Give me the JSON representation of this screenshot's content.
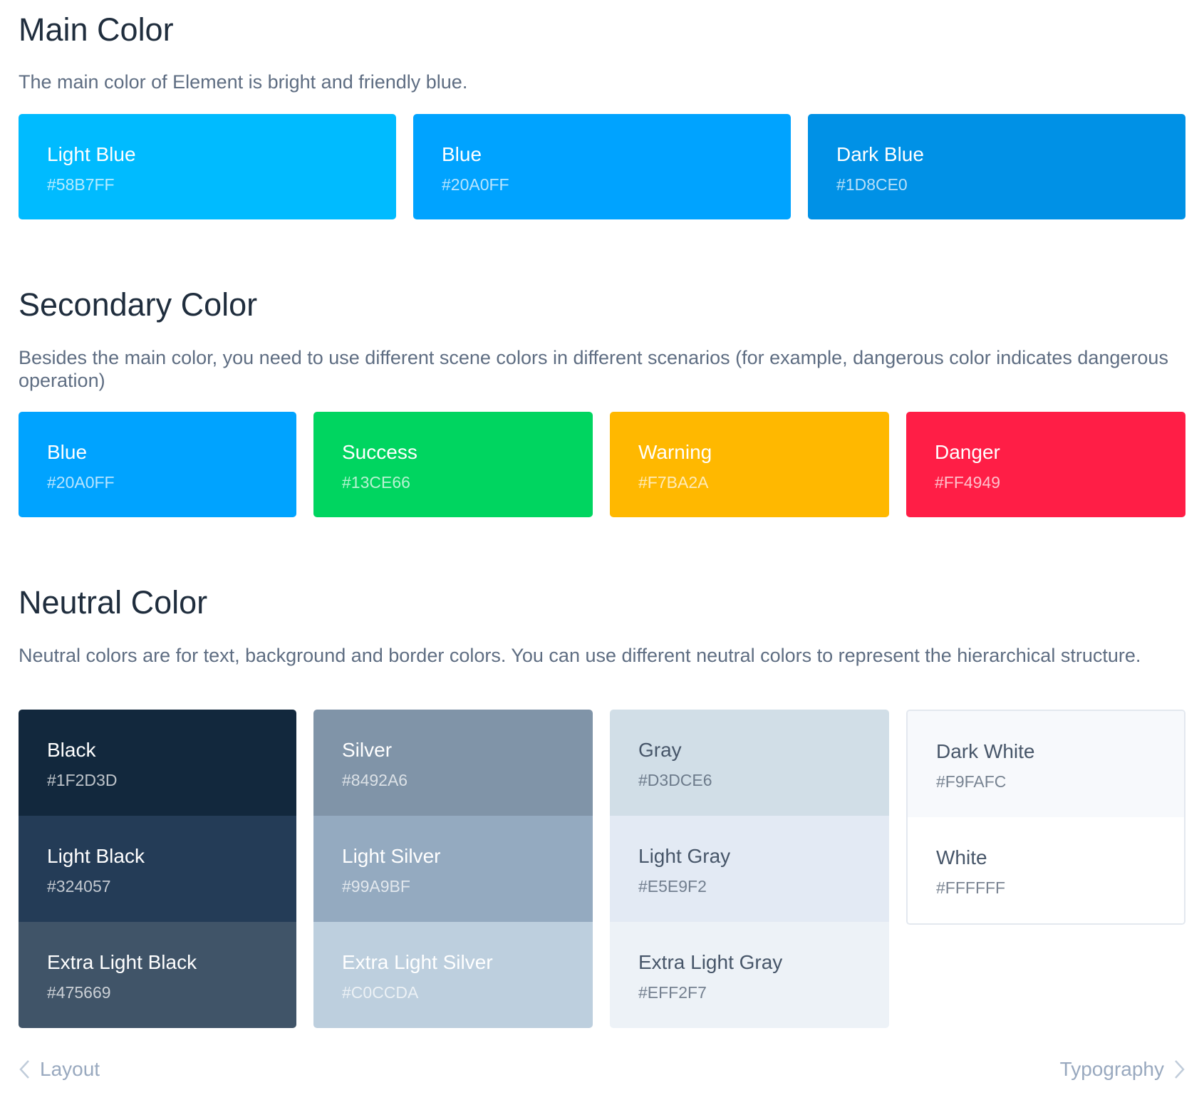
{
  "main": {
    "title": "Main Color",
    "desc": "The main color of Element is bright and friendly blue.",
    "swatches": [
      {
        "name": "Light Blue",
        "hex": "#58B7FF",
        "color": "#00BBFF"
      },
      {
        "name": "Blue",
        "hex": "#20A0FF",
        "color": "#00A3FF"
      },
      {
        "name": "Dark Blue",
        "hex": "#1D8CE0",
        "color": "#0091E6"
      }
    ]
  },
  "secondary": {
    "title": "Secondary Color",
    "desc": "Besides the main color, you need to use different scene colors in different scenarios (for example, dangerous color indicates dangerous operation)",
    "swatches": [
      {
        "name": "Blue",
        "hex": "#20A0FF",
        "color": "#00A3FF"
      },
      {
        "name": "Success",
        "hex": "#13CE66",
        "color": "#00D560"
      },
      {
        "name": "Warning",
        "hex": "#F7BA2A",
        "color": "#FFB800"
      },
      {
        "name": "Danger",
        "hex": "#FF4949",
        "color": "#FF1E46"
      }
    ]
  },
  "neutral": {
    "title": "Neutral Color",
    "desc": "Neutral colors are for text, background and border colors. You can use different neutral colors to represent the hierarchical structure.",
    "groups": [
      [
        {
          "name": "Black",
          "hex": "#1F2D3D",
          "color": "#12283D",
          "text": "#FFFFFF"
        },
        {
          "name": "Light Black",
          "hex": "#324057",
          "color": "#243C57",
          "text": "#FFFFFF"
        },
        {
          "name": "Extra Light Black",
          "hex": "#475669",
          "color": "#405468",
          "text": "#FFFFFF"
        }
      ],
      [
        {
          "name": "Silver",
          "hex": "#8492A6",
          "color": "#8094A8",
          "text": "#FFFFFF"
        },
        {
          "name": "Light Silver",
          "hex": "#99A9BF",
          "color": "#94AAC0",
          "text": "#FFFFFF"
        },
        {
          "name": "Extra Light Silver",
          "hex": "#C0CCDA",
          "color": "#BDCFDE",
          "text": "#FFFFFF"
        }
      ],
      [
        {
          "name": "Gray",
          "hex": "#D3DCE6",
          "color": "#D1DEE7",
          "text": "#475669"
        },
        {
          "name": "Light Gray",
          "hex": "#E5E9F2",
          "color": "#E3EAF4",
          "text": "#475669"
        },
        {
          "name": "Extra Light Gray",
          "hex": "#EFF2F7",
          "color": "#EDF2F7",
          "text": "#475669"
        }
      ],
      [
        {
          "name": "Dark White",
          "hex": "#F9FAFC",
          "color": "#F7F9FC",
          "text": "#475669"
        },
        {
          "name": "White",
          "hex": "#FFFFFF",
          "color": "#FFFFFF",
          "text": "#475669"
        }
      ]
    ]
  },
  "footer": {
    "prev_label": "Layout",
    "next_label": "Typography"
  }
}
